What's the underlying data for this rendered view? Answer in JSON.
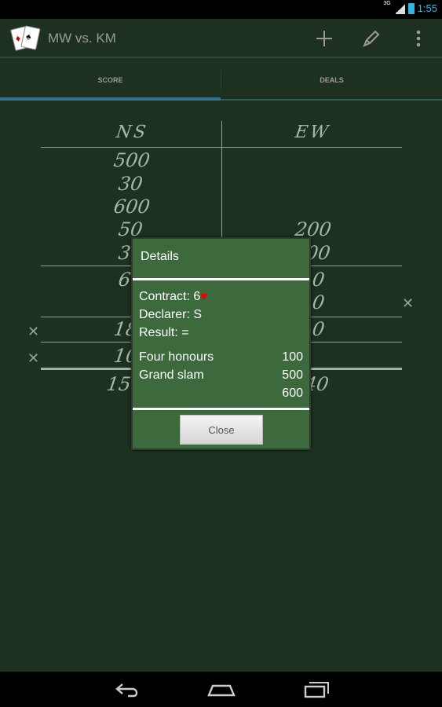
{
  "status_bar": {
    "signal_label": "3G",
    "time": "1:55",
    "colors": {
      "accent": "#33b5e5"
    }
  },
  "action_bar": {
    "title": "MW vs. KM",
    "actions": [
      {
        "icon": "plus-icon"
      },
      {
        "icon": "pencil-icon"
      },
      {
        "icon": "overflow-menu-icon"
      }
    ]
  },
  "tabs": [
    {
      "label": "SCORE",
      "selected": true
    },
    {
      "label": "DEALS",
      "selected": false
    }
  ],
  "scoresheet": {
    "headers": {
      "ns": "NS",
      "ew": "EW"
    },
    "ns_scores": [
      "500",
      "30",
      "600",
      "50",
      "3",
      "6",
      "18",
      "10",
      "15"
    ],
    "ew_scores": [
      "200",
      "00",
      "0",
      "0",
      "0",
      "40"
    ]
  },
  "dialog": {
    "title": "Details",
    "contract_label": "Contract: 6",
    "contract_suit": "♥",
    "declarer": "Declarer: S",
    "result": "Result: =",
    "bonuses": [
      {
        "label": "Four honours",
        "value": "100"
      },
      {
        "label": "Grand slam",
        "value": "500"
      }
    ],
    "total": "600",
    "close_label": "Close"
  },
  "colors": {
    "background": "#1e3120",
    "dialog_bg": "#3c6a3c",
    "tab_indicator": "#33748e",
    "heart": "#e00000"
  }
}
